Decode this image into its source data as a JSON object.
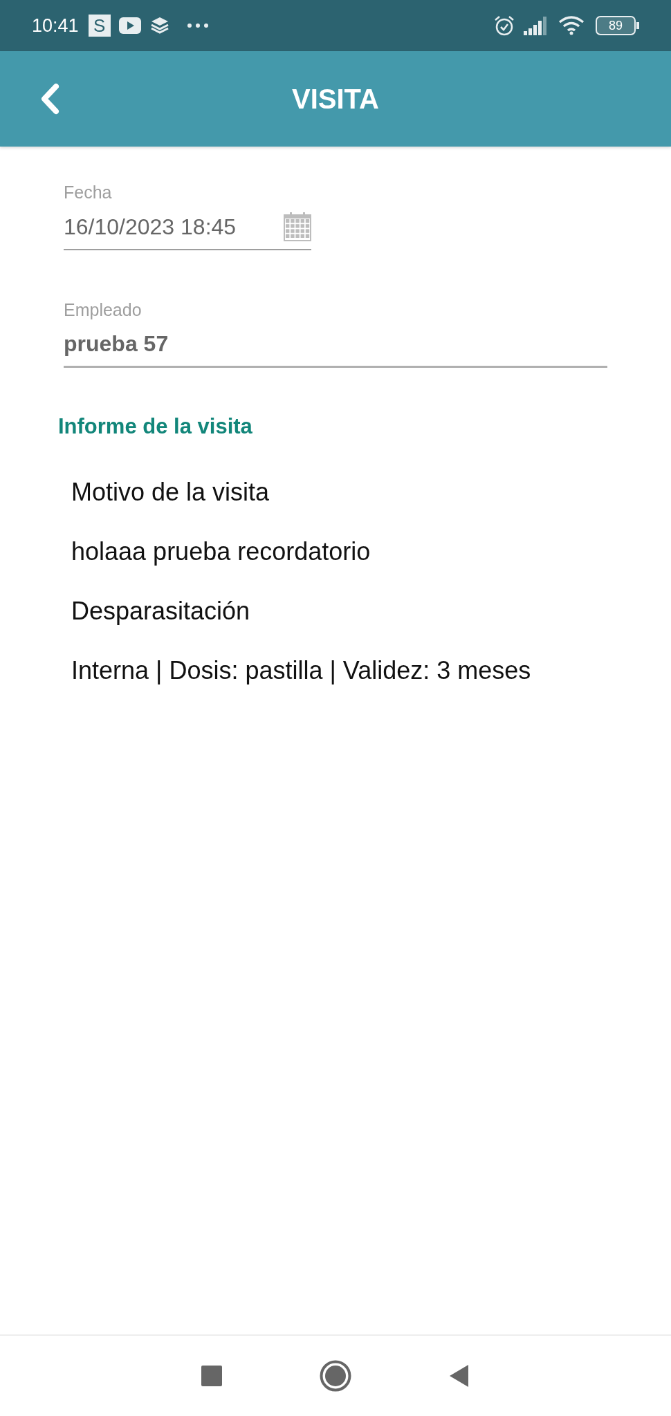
{
  "status_bar": {
    "time": "10:41",
    "app_badge": "S",
    "battery": "89"
  },
  "header": {
    "title": "VISITA"
  },
  "fields": [
    {
      "label": "Fecha",
      "value": "16/10/2023 18:45",
      "kind": "date"
    },
    {
      "label": "Empleado",
      "value": "prueba 57",
      "kind": "text"
    }
  ],
  "report": {
    "title": "Informe de la visita",
    "lines": [
      "Motivo de la visita",
      "holaaa prueba recordatorio",
      "Desparasitación",
      "Interna | Dosis: pastilla | Validez: 3 meses"
    ]
  }
}
